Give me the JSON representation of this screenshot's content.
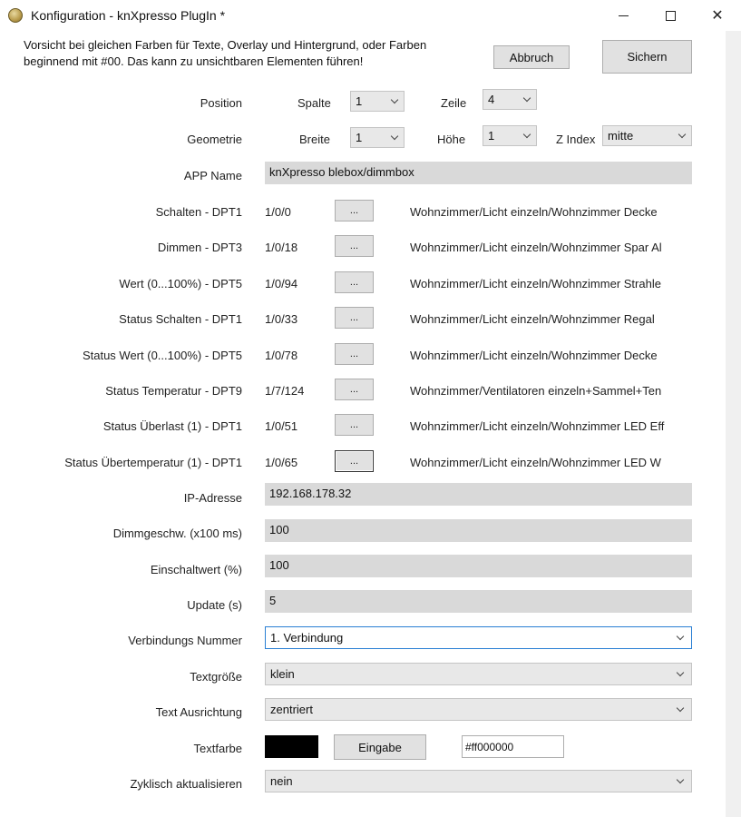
{
  "window": {
    "title": "Konfiguration - knXpresso PlugIn *",
    "minimize": "minimize",
    "maximize": "maximize",
    "close": "✕"
  },
  "warning": {
    "line1": "Vorsicht bei gleichen Farben für Texte, Overlay und Hintergrund, oder Farben",
    "line2": "beginnend mit #00. Das kann zu unsichtbaren Elementen führen!"
  },
  "buttons": {
    "cancel": "Abbruch",
    "save": "Sichern"
  },
  "position": {
    "label": "Position",
    "spalte_label": "Spalte",
    "spalte_value": "1",
    "zeile_label": "Zeile",
    "zeile_value": "4"
  },
  "geometrie": {
    "label": "Geometrie",
    "breite_label": "Breite",
    "breite_value": "1",
    "hoehe_label": "Höhe",
    "hoehe_value": "1",
    "zindex_label": "Z Index",
    "zindex_value": "mitte"
  },
  "app_name": {
    "label": "APP Name",
    "value": "knXpresso blebox/dimmbox"
  },
  "group_addresses": [
    {
      "label": "Schalten - DPT1",
      "address": "1/0/0",
      "button": "...",
      "name": "Wohnzimmer/Licht einzeln/Wohnzimmer Decke"
    },
    {
      "label": "Dimmen - DPT3",
      "address": "1/0/18",
      "button": "...",
      "name": "Wohnzimmer/Licht einzeln/Wohnzimmer Spar Al"
    },
    {
      "label": "Wert (0...100%) - DPT5",
      "address": "1/0/94",
      "button": "...",
      "name": "Wohnzimmer/Licht einzeln/Wohnzimmer Strahle"
    },
    {
      "label": "Status Schalten - DPT1",
      "address": "1/0/33",
      "button": "...",
      "name": "Wohnzimmer/Licht einzeln/Wohnzimmer Regal"
    },
    {
      "label": "Status Wert (0...100%) - DPT5",
      "address": "1/0/78",
      "button": "...",
      "name": "Wohnzimmer/Licht einzeln/Wohnzimmer Decke"
    },
    {
      "label": "Status Temperatur - DPT9",
      "address": "1/7/124",
      "button": "...",
      "name": "Wohnzimmer/Ventilatoren einzeln+Sammel+Ten"
    },
    {
      "label": "Status Überlast (1) - DPT1",
      "address": "1/0/51",
      "button": "...",
      "name": "Wohnzimmer/Licht einzeln/Wohnzimmer LED Eff"
    },
    {
      "label": "Status Übertemperatur (1) - DPT1",
      "address": "1/0/65",
      "button": "...",
      "name": "Wohnzimmer/Licht einzeln/Wohnzimmer LED W"
    }
  ],
  "ip": {
    "label": "IP-Adresse",
    "value": "192.168.178.32"
  },
  "dimmgeschw": {
    "label": "Dimmgeschw. (x100 ms)",
    "value": "100"
  },
  "einschaltwert": {
    "label": "Einschaltwert (%)",
    "value": "100"
  },
  "update": {
    "label": "Update (s)",
    "value": "5"
  },
  "verbindung": {
    "label": "Verbindungs Nummer",
    "value": "1. Verbindung"
  },
  "textgroesse": {
    "label": "Textgröße",
    "value": "klein"
  },
  "ausrichtung": {
    "label": "Text Ausrichtung",
    "value": "zentriert"
  },
  "textfarbe": {
    "label": "Textfarbe",
    "button": "Eingabe",
    "hex": "#ff000000",
    "swatch_color": "#000000"
  },
  "zyklisch": {
    "label": "Zyklisch aktualisieren",
    "value": "nein"
  }
}
